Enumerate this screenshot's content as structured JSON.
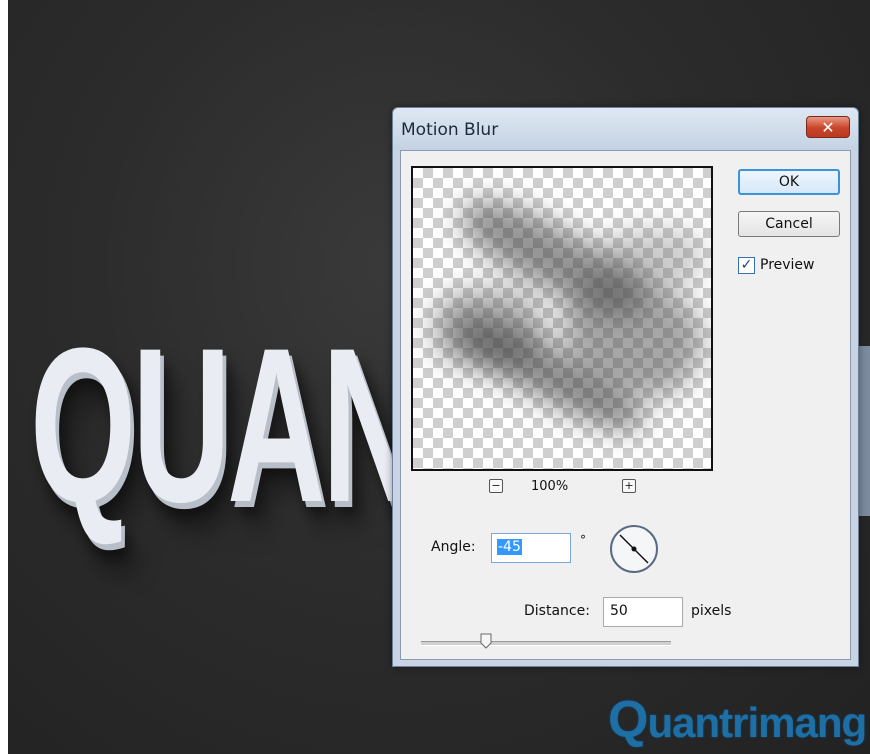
{
  "canvas": {
    "headline": "QUAN",
    "watermark": "uantrimang",
    "watermark_q": "Q"
  },
  "dialog": {
    "title": "Motion Blur",
    "close_glyph": "✕",
    "ok_label": "OK",
    "cancel_label": "Cancel",
    "preview_label": "Preview",
    "preview_checked": true,
    "zoom_minus": "−",
    "zoom_plus": "+",
    "zoom_value": "100%",
    "angle_label": "Angle:",
    "angle_value": "-45",
    "degree_symbol": "°",
    "distance_label": "Distance:",
    "distance_value": "50",
    "distance_unit": "pixels",
    "distance_slider_fraction": 0.26
  },
  "colors": {
    "accent": "#3399ff",
    "watermark": "#1d6fa5",
    "close": "#c8442a"
  },
  "icons": {
    "close": "close-icon",
    "check": "checkmark-icon",
    "dial": "angle-dial-icon",
    "thumb": "slider-thumb-icon"
  }
}
